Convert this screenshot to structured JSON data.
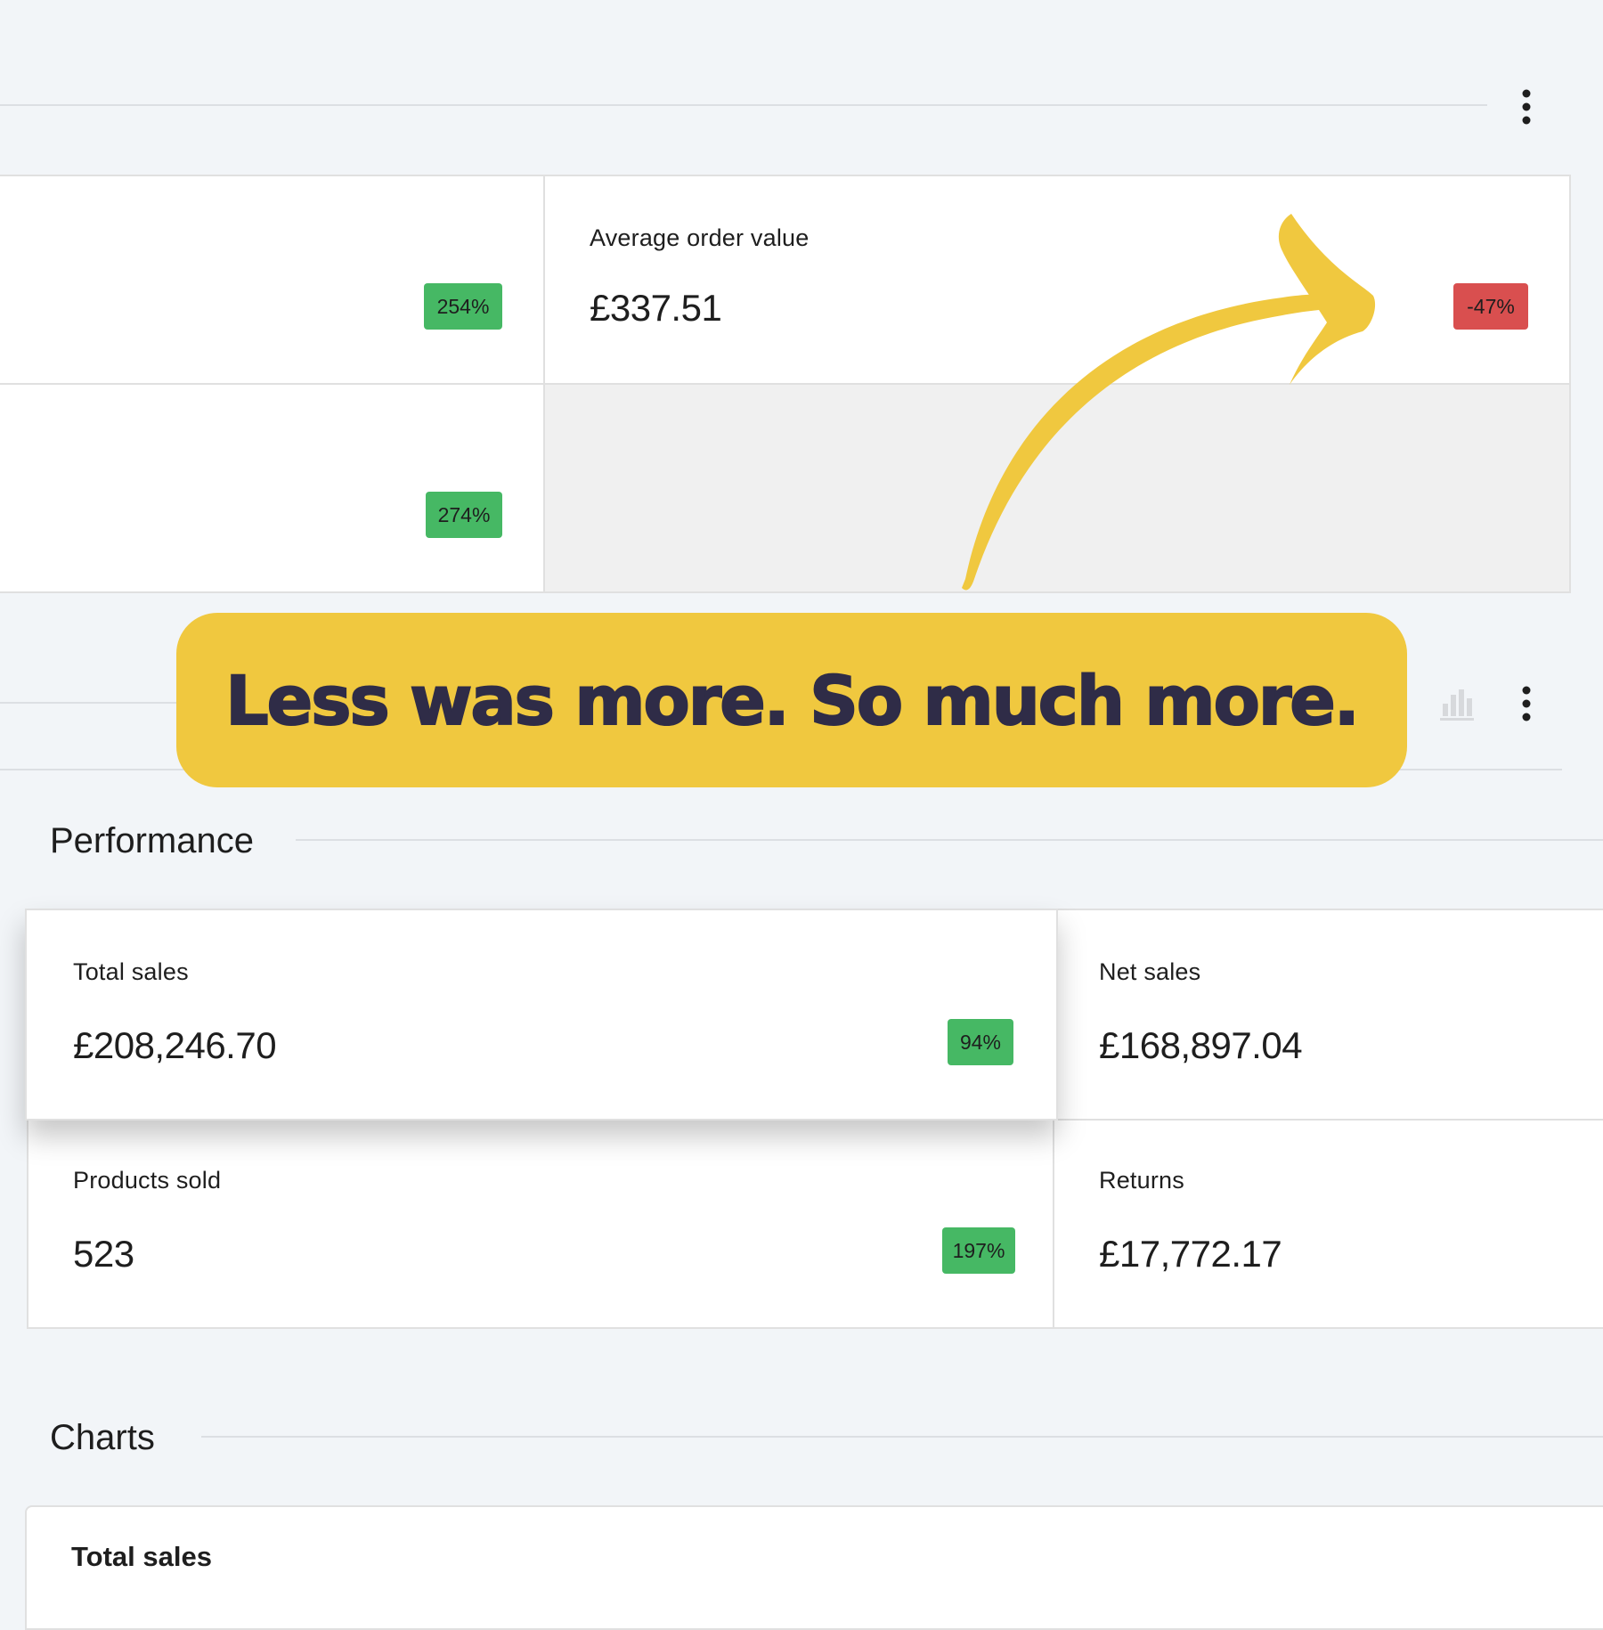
{
  "top_section": {
    "menu_icon": "more-vertical-icon",
    "cells": [
      {
        "badge": "254%"
      },
      {
        "label": "Average order value",
        "value": "£337.51",
        "badge": "-47%"
      },
      {
        "badge": "274%"
      }
    ]
  },
  "callout": {
    "text": "Less was more. So much more."
  },
  "toolbar": {
    "chart_icon": "bar-chart-icon",
    "menu_icon": "more-vertical-icon"
  },
  "performance": {
    "title": "Performance",
    "cards": [
      {
        "label": "Total sales",
        "value": "£208,246.70",
        "badge": "94%"
      },
      {
        "label": "Net sales",
        "value": "£168,897.04"
      },
      {
        "label": "Products sold",
        "value": "523",
        "badge": "197%"
      },
      {
        "label": "Returns",
        "value": "£17,772.17"
      }
    ]
  },
  "charts": {
    "title": "Charts",
    "first_chart_title": "Total sales"
  },
  "colors": {
    "badge_up": "#46b864",
    "badge_down": "#d94f4f",
    "callout_bg": "#f0c83f",
    "callout_text": "#2f2c47",
    "arrow": "#f0c83f"
  }
}
